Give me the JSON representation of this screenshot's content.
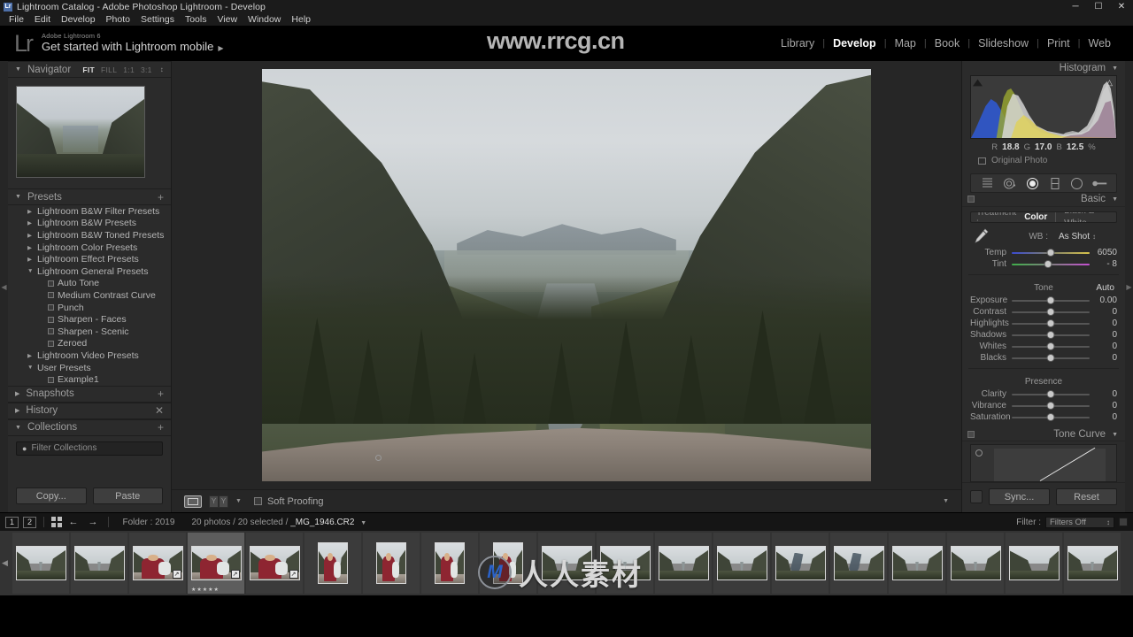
{
  "titlebar": {
    "title": "Lightroom Catalog - Adobe Photoshop Lightroom - Develop",
    "logo": "Lr",
    "minimize": "─",
    "maximize": "☐",
    "close": "✕"
  },
  "menubar": {
    "items": [
      "File",
      "Edit",
      "Develop",
      "Photo",
      "Settings",
      "Tools",
      "View",
      "Window",
      "Help"
    ]
  },
  "identity": {
    "logo": "Lr",
    "small_line": "Adobe Lightroom 6",
    "big_line": "Get started with Lightroom mobile",
    "arrow": "▶"
  },
  "modules": {
    "items": [
      "Library",
      "Develop",
      "Map",
      "Book",
      "Slideshow",
      "Print",
      "Web"
    ],
    "active": "Develop",
    "separator": "|"
  },
  "watermarks": {
    "top": "www.rrcg.cn",
    "bottom_text": "人人素材",
    "bottom_mark": "M"
  },
  "navigator": {
    "title": "Navigator",
    "triangle": "▼",
    "modes": [
      "FIT",
      "FILL",
      "1:1",
      "3:1"
    ],
    "active_mode": "FIT",
    "stepper": "↕"
  },
  "presets": {
    "title": "Presets",
    "triangle": "▼",
    "plus": "+",
    "groups": [
      {
        "label": "Lightroom B&W Filter Presets",
        "open": false,
        "children": []
      },
      {
        "label": "Lightroom B&W Presets",
        "open": false,
        "children": []
      },
      {
        "label": "Lightroom B&W Toned Presets",
        "open": false,
        "children": []
      },
      {
        "label": "Lightroom Color Presets",
        "open": false,
        "children": []
      },
      {
        "label": "Lightroom Effect Presets",
        "open": false,
        "children": []
      },
      {
        "label": "Lightroom General Presets",
        "open": true,
        "children": [
          "Auto Tone",
          "Medium Contrast Curve",
          "Punch",
          "Sharpen - Faces",
          "Sharpen - Scenic",
          "Zeroed"
        ]
      },
      {
        "label": "Lightroom Video Presets",
        "open": false,
        "children": []
      },
      {
        "label": "User Presets",
        "open": true,
        "children": [
          "Example1"
        ]
      }
    ],
    "tri_closed": "▶",
    "tri_open": "▼"
  },
  "snapshots": {
    "title": "Snapshots",
    "triangle": "▶",
    "plus": "+"
  },
  "history": {
    "title": "History",
    "triangle": "▶",
    "close": "✕"
  },
  "collections": {
    "title": "Collections",
    "triangle": "▼",
    "plus": "+",
    "filter_placeholder": "Filter Collections",
    "search_icon": "🔍"
  },
  "copy_paste": {
    "copy": "Copy...",
    "paste": "Paste"
  },
  "toolbar": {
    "view_icon": "loupe-view",
    "compare_icon": "YY",
    "caret": "▼",
    "soft_proofing": "Soft Proofing",
    "right_caret": "▼"
  },
  "histogram": {
    "title": "Histogram",
    "triangle": "▼",
    "r_label": "R",
    "r_value": "18.8",
    "g_label": "G",
    "g_value": "17.0",
    "b_label": "B",
    "b_value": "12.5",
    "unit": "%",
    "original_photo": "Original Photo",
    "shadow_clip": "▲",
    "highlight_clip": "△"
  },
  "tools": {
    "items": [
      "crop-overlay-icon",
      "spot-removal-icon",
      "red-eye-icon",
      "graduated-filter-icon",
      "radial-filter-icon",
      "adjustment-brush-icon"
    ],
    "selected": "red-eye-icon"
  },
  "basic": {
    "title": "Basic",
    "triangle": "▼",
    "treatment_label": "Treatment :",
    "treatment_options": [
      "Color",
      "Black & White"
    ],
    "treatment_selected": "Color",
    "wb_label": "WB :",
    "wb_value": "As Shot",
    "wb_stepper": "↕",
    "eyedropper": "white-balance-selector-icon",
    "wb_sliders": [
      {
        "name": "Temp",
        "value": "6050",
        "pos": 50,
        "kind": "temp"
      },
      {
        "name": "Tint",
        "value": "- 8",
        "pos": 47,
        "kind": "tint"
      }
    ],
    "tone_title": "Tone",
    "auto_label": "Auto",
    "tone_sliders": [
      {
        "name": "Exposure",
        "value": "0.00",
        "pos": 50
      },
      {
        "name": "Contrast",
        "value": "0",
        "pos": 50
      },
      {
        "name": "Highlights",
        "value": "0",
        "pos": 50
      },
      {
        "name": "Shadows",
        "value": "0",
        "pos": 50
      },
      {
        "name": "Whites",
        "value": "0",
        "pos": 50
      },
      {
        "name": "Blacks",
        "value": "0",
        "pos": 50
      }
    ],
    "presence_title": "Presence",
    "presence_sliders": [
      {
        "name": "Clarity",
        "value": "0",
        "pos": 50
      },
      {
        "name": "Vibrance",
        "value": "0",
        "pos": 50
      },
      {
        "name": "Saturation",
        "value": "0",
        "pos": 50
      }
    ]
  },
  "tone_curve": {
    "title": "Tone Curve",
    "triangle": "▼",
    "target_icon": "target-adjust-icon"
  },
  "sync": {
    "sync_label": "Sync...",
    "reset_label": "Reset"
  },
  "filmstrip_bar": {
    "view1": "1",
    "view2": "2",
    "grid_icon": "grid-view-icon",
    "back_arrow": "←",
    "fwd_arrow": "→",
    "folder_label": "Folder : 2019",
    "photo_info": "20 photos / 20 selected / ",
    "filename": "_MG_1946.CR2",
    "caret": "▼",
    "filter_label": "Filter :",
    "filter_value": "Filters Off",
    "filter_stepper": "↕"
  },
  "filmstrip": {
    "left_arrow": "◀",
    "thumbnails": [
      {
        "kind": "valley",
        "orientation": "landscape",
        "selected": false,
        "badge": "",
        "stars": ""
      },
      {
        "kind": "valley",
        "orientation": "landscape",
        "selected": false,
        "badge": "",
        "stars": ""
      },
      {
        "kind": "person-rock",
        "orientation": "landscape",
        "selected": false,
        "badge": "↗",
        "stars": ""
      },
      {
        "kind": "person-red",
        "orientation": "landscape",
        "selected": true,
        "badge": "↗",
        "stars": "★★★★★"
      },
      {
        "kind": "person-red",
        "orientation": "landscape",
        "selected": false,
        "badge": "↗",
        "stars": ""
      },
      {
        "kind": "person-red",
        "orientation": "portrait",
        "selected": false,
        "badge": "",
        "stars": ""
      },
      {
        "kind": "person-red",
        "orientation": "portrait",
        "selected": false,
        "badge": "",
        "stars": ""
      },
      {
        "kind": "person-red",
        "orientation": "portrait",
        "selected": false,
        "badge": "",
        "stars": ""
      },
      {
        "kind": "person-red",
        "orientation": "portrait",
        "selected": false,
        "badge": "",
        "stars": ""
      },
      {
        "kind": "valley",
        "orientation": "landscape",
        "selected": false,
        "badge": "",
        "stars": ""
      },
      {
        "kind": "valley",
        "orientation": "landscape",
        "selected": false,
        "badge": "",
        "stars": ""
      },
      {
        "kind": "valley",
        "orientation": "landscape",
        "selected": false,
        "badge": "",
        "stars": ""
      },
      {
        "kind": "valley",
        "orientation": "landscape",
        "selected": false,
        "badge": "",
        "stars": ""
      },
      {
        "kind": "river",
        "orientation": "landscape",
        "selected": false,
        "badge": "",
        "stars": ""
      },
      {
        "kind": "river",
        "orientation": "landscape",
        "selected": false,
        "badge": "",
        "stars": ""
      },
      {
        "kind": "valley",
        "orientation": "landscape",
        "selected": false,
        "badge": "",
        "stars": ""
      },
      {
        "kind": "valley",
        "orientation": "landscape",
        "selected": false,
        "badge": "",
        "stars": ""
      },
      {
        "kind": "ridge",
        "orientation": "landscape",
        "selected": false,
        "badge": "",
        "stars": ""
      },
      {
        "kind": "valley",
        "orientation": "landscape",
        "selected": false,
        "badge": "",
        "stars": ""
      }
    ]
  }
}
